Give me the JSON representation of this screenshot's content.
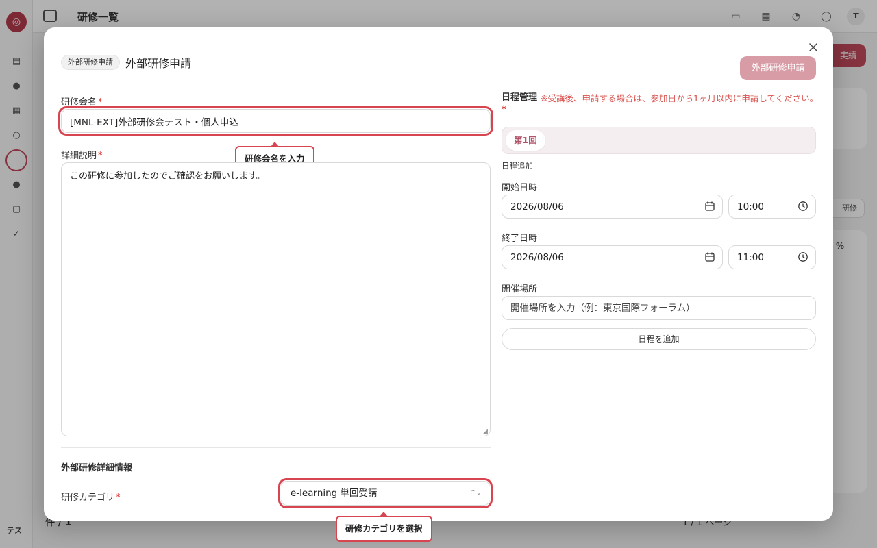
{
  "background": {
    "page_title": "研修一覧",
    "user_initials": "テス",
    "avatar_initial": "T",
    "primary_button": "実績",
    "secondary_button": "研修",
    "percent_label": "%",
    "footer_left": "件 / 1",
    "footer_right": "1 / 1 ページ"
  },
  "modal": {
    "badge": "外部研修申請",
    "title": "外部研修申請",
    "submit_label": "外部研修申請",
    "left": {
      "name_label": "研修会名",
      "name_value": "[MNL-EXT]外部研修会テスト・個人申込",
      "desc_label": "詳細説明",
      "desc_value": "この研修に参加したのでご確認をお願いします。",
      "section_title": "外部研修詳細情報",
      "category_label": "研修カテゴリ",
      "category_value": "e-learning 単回受講"
    },
    "right": {
      "schedule_label": "日程管理",
      "schedule_note": "※受講後、申請する場合は、参加日から1ヶ月以内に申請してください。",
      "tab_label": "第1回",
      "add_date_link": "日程追加",
      "start_label": "開始日時",
      "start_date": "2026/08/06",
      "start_time": "10:00",
      "end_label": "終了日時",
      "end_date": "2026/08/06",
      "end_time": "11:00",
      "venue_label": "開催場所",
      "venue_placeholder": "開催場所を入力（例：東京国際フォーラム）",
      "add_schedule_label": "日程を追加"
    },
    "required_mark": "*"
  },
  "tooltips": {
    "name_tip": "研修会名を入力",
    "category_tip": "研修カテゴリを選択"
  },
  "colors": {
    "accent": "#b2536a",
    "highlight": "#d64550",
    "submit_disabled": "#d89ca6",
    "note": "#d9534f"
  }
}
